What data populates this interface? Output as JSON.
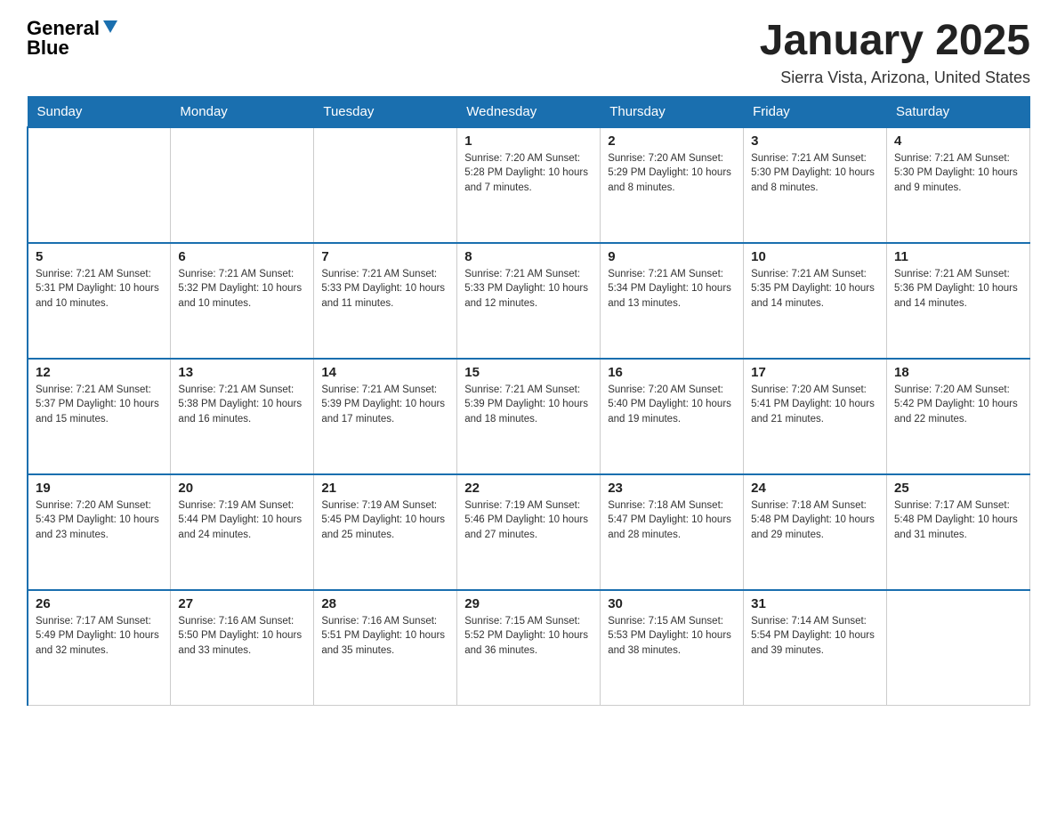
{
  "header": {
    "logo_line1": "General",
    "logo_line2": "Blue",
    "month_title": "January 2025",
    "location": "Sierra Vista, Arizona, United States"
  },
  "days_of_week": [
    "Sunday",
    "Monday",
    "Tuesday",
    "Wednesday",
    "Thursday",
    "Friday",
    "Saturday"
  ],
  "weeks": [
    [
      {
        "day": "",
        "info": ""
      },
      {
        "day": "",
        "info": ""
      },
      {
        "day": "",
        "info": ""
      },
      {
        "day": "1",
        "info": "Sunrise: 7:20 AM\nSunset: 5:28 PM\nDaylight: 10 hours and 7 minutes."
      },
      {
        "day": "2",
        "info": "Sunrise: 7:20 AM\nSunset: 5:29 PM\nDaylight: 10 hours and 8 minutes."
      },
      {
        "day": "3",
        "info": "Sunrise: 7:21 AM\nSunset: 5:30 PM\nDaylight: 10 hours and 8 minutes."
      },
      {
        "day": "4",
        "info": "Sunrise: 7:21 AM\nSunset: 5:30 PM\nDaylight: 10 hours and 9 minutes."
      }
    ],
    [
      {
        "day": "5",
        "info": "Sunrise: 7:21 AM\nSunset: 5:31 PM\nDaylight: 10 hours and 10 minutes."
      },
      {
        "day": "6",
        "info": "Sunrise: 7:21 AM\nSunset: 5:32 PM\nDaylight: 10 hours and 10 minutes."
      },
      {
        "day": "7",
        "info": "Sunrise: 7:21 AM\nSunset: 5:33 PM\nDaylight: 10 hours and 11 minutes."
      },
      {
        "day": "8",
        "info": "Sunrise: 7:21 AM\nSunset: 5:33 PM\nDaylight: 10 hours and 12 minutes."
      },
      {
        "day": "9",
        "info": "Sunrise: 7:21 AM\nSunset: 5:34 PM\nDaylight: 10 hours and 13 minutes."
      },
      {
        "day": "10",
        "info": "Sunrise: 7:21 AM\nSunset: 5:35 PM\nDaylight: 10 hours and 14 minutes."
      },
      {
        "day": "11",
        "info": "Sunrise: 7:21 AM\nSunset: 5:36 PM\nDaylight: 10 hours and 14 minutes."
      }
    ],
    [
      {
        "day": "12",
        "info": "Sunrise: 7:21 AM\nSunset: 5:37 PM\nDaylight: 10 hours and 15 minutes."
      },
      {
        "day": "13",
        "info": "Sunrise: 7:21 AM\nSunset: 5:38 PM\nDaylight: 10 hours and 16 minutes."
      },
      {
        "day": "14",
        "info": "Sunrise: 7:21 AM\nSunset: 5:39 PM\nDaylight: 10 hours and 17 minutes."
      },
      {
        "day": "15",
        "info": "Sunrise: 7:21 AM\nSunset: 5:39 PM\nDaylight: 10 hours and 18 minutes."
      },
      {
        "day": "16",
        "info": "Sunrise: 7:20 AM\nSunset: 5:40 PM\nDaylight: 10 hours and 19 minutes."
      },
      {
        "day": "17",
        "info": "Sunrise: 7:20 AM\nSunset: 5:41 PM\nDaylight: 10 hours and 21 minutes."
      },
      {
        "day": "18",
        "info": "Sunrise: 7:20 AM\nSunset: 5:42 PM\nDaylight: 10 hours and 22 minutes."
      }
    ],
    [
      {
        "day": "19",
        "info": "Sunrise: 7:20 AM\nSunset: 5:43 PM\nDaylight: 10 hours and 23 minutes."
      },
      {
        "day": "20",
        "info": "Sunrise: 7:19 AM\nSunset: 5:44 PM\nDaylight: 10 hours and 24 minutes."
      },
      {
        "day": "21",
        "info": "Sunrise: 7:19 AM\nSunset: 5:45 PM\nDaylight: 10 hours and 25 minutes."
      },
      {
        "day": "22",
        "info": "Sunrise: 7:19 AM\nSunset: 5:46 PM\nDaylight: 10 hours and 27 minutes."
      },
      {
        "day": "23",
        "info": "Sunrise: 7:18 AM\nSunset: 5:47 PM\nDaylight: 10 hours and 28 minutes."
      },
      {
        "day": "24",
        "info": "Sunrise: 7:18 AM\nSunset: 5:48 PM\nDaylight: 10 hours and 29 minutes."
      },
      {
        "day": "25",
        "info": "Sunrise: 7:17 AM\nSunset: 5:48 PM\nDaylight: 10 hours and 31 minutes."
      }
    ],
    [
      {
        "day": "26",
        "info": "Sunrise: 7:17 AM\nSunset: 5:49 PM\nDaylight: 10 hours and 32 minutes."
      },
      {
        "day": "27",
        "info": "Sunrise: 7:16 AM\nSunset: 5:50 PM\nDaylight: 10 hours and 33 minutes."
      },
      {
        "day": "28",
        "info": "Sunrise: 7:16 AM\nSunset: 5:51 PM\nDaylight: 10 hours and 35 minutes."
      },
      {
        "day": "29",
        "info": "Sunrise: 7:15 AM\nSunset: 5:52 PM\nDaylight: 10 hours and 36 minutes."
      },
      {
        "day": "30",
        "info": "Sunrise: 7:15 AM\nSunset: 5:53 PM\nDaylight: 10 hours and 38 minutes."
      },
      {
        "day": "31",
        "info": "Sunrise: 7:14 AM\nSunset: 5:54 PM\nDaylight: 10 hours and 39 minutes."
      },
      {
        "day": "",
        "info": ""
      }
    ]
  ]
}
